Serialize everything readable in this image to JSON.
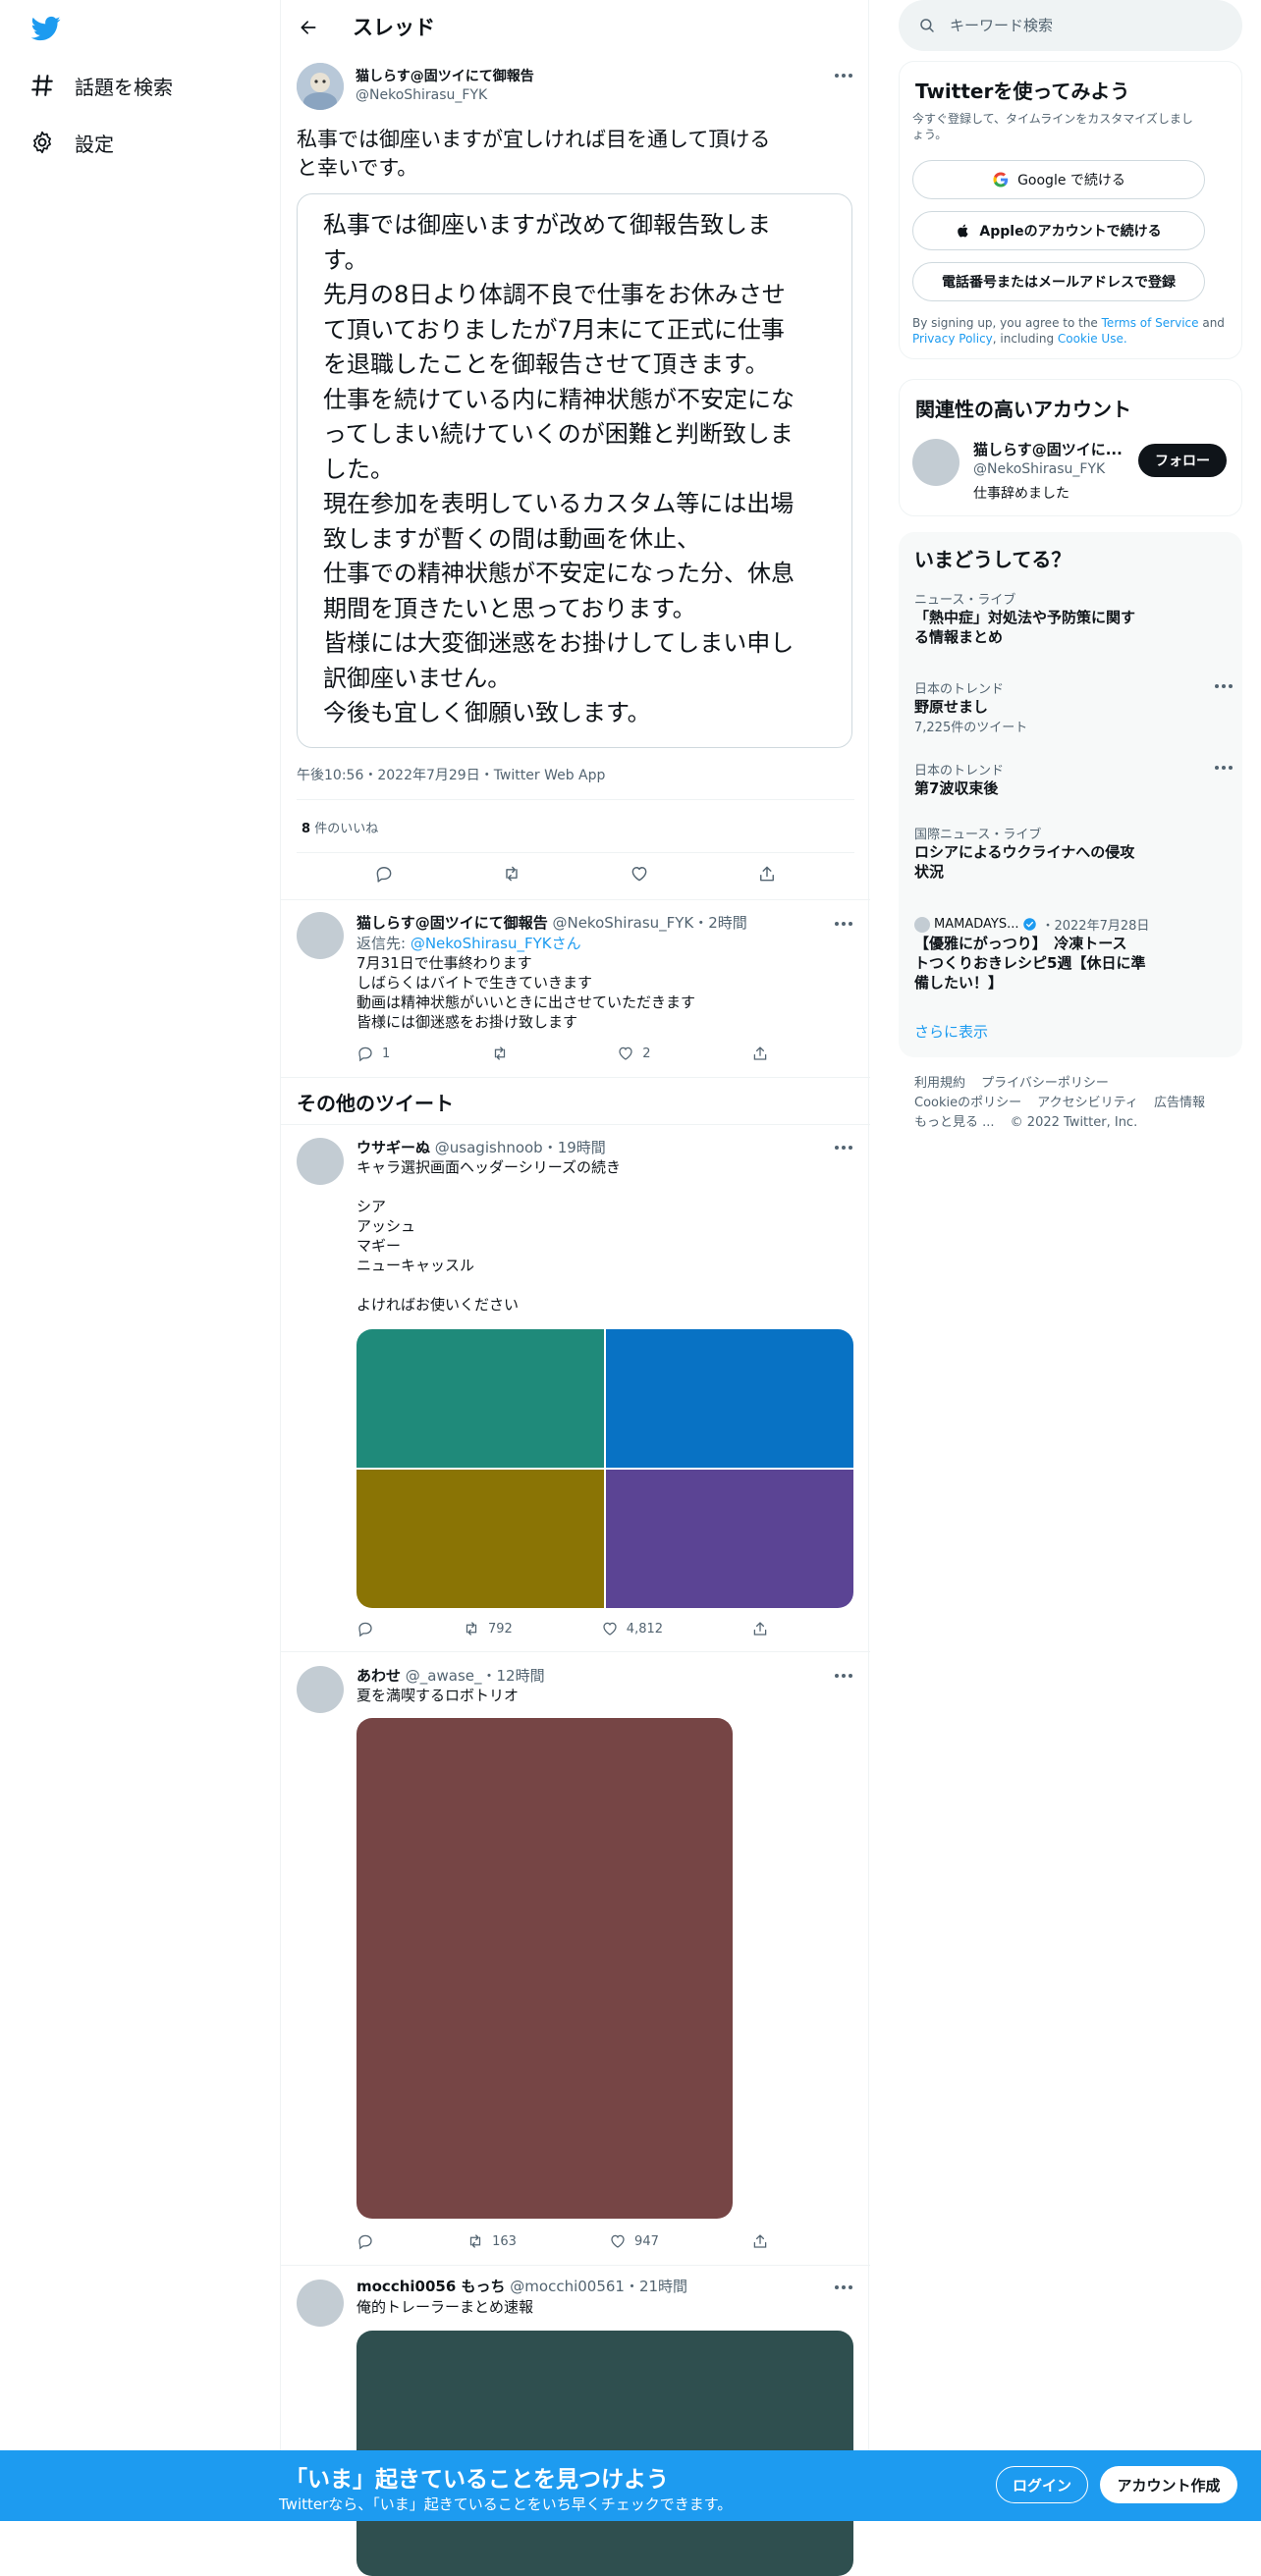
{
  "nav": {
    "explore": "話題を検索",
    "settings": "設定"
  },
  "header": {
    "title": "スレッド"
  },
  "main_tweet": {
    "name": "猫しらす@固ツイにて御報告",
    "handle": "@NekoShirasu_FYK",
    "text_lines": [
      "私事では御座いますが宜しければ目を通して頂ける",
      "と幸いです。"
    ],
    "quote_lines": [
      "私事では御座いますが改めて御報告致しま",
      "す。",
      "先月の8日より体調不良で仕事をお休みさせ",
      "て頂いておりましたが7月末にて正式に仕事",
      "を退職したことを御報告させて頂きます。",
      "仕事を続けている内に精神状態が不安定にな",
      "ってしまい続けていくのが困難と判断致しま",
      "した。",
      "現在参加を表明しているカスタム等には出場",
      "致しますが暫くの間は動画を休止、",
      "仕事での精神状態が不安定になった分、休息",
      "期間を頂きたいと思っております。",
      "皆様には大変御迷惑をお掛けしてしまい申し",
      "訳御座いません。",
      "今後も宜しく御願い致します。"
    ],
    "timestamp": "午後10:56・2022年7月29日・Twitter Web App",
    "likes_count": "8",
    "likes_label": "件のいいね"
  },
  "reply": {
    "name": "猫しらす@固ツイにて御報告",
    "handle_time": "@NekoShirasu_FYK・2時間",
    "reply_prefix": "返信先: ",
    "reply_to": "@NekoShirasu_FYK",
    "reply_suffix": "さん",
    "lines": [
      "7月31日で仕事終わります",
      "しばらくはバイトで生きていきます",
      "動画は精神状態がいいときに出させていただきます",
      "皆様には御迷惑をお掛け致します"
    ],
    "replies": "1",
    "retweets": "",
    "likes": "2"
  },
  "other_tweets_title": "その他のツイート",
  "tweet1": {
    "name": "ウサギーぬ",
    "handle_time": "@usagishnoob・19時間",
    "lines": [
      "キャラ選択画面ヘッダーシリーズの続き",
      "",
      "シア",
      "アッシュ",
      "マギー",
      "ニューキャッスル",
      "",
      "よければお使いください"
    ],
    "retweets": "792",
    "likes": "4,812",
    "media_colors": [
      "#1f8a7a",
      "#0872c4",
      "#8a7405",
      "#5b4494"
    ]
  },
  "tweet2": {
    "name": "あわせ",
    "handle_time": "@_awase_・12時間",
    "text": "夏を満喫するロボトリオ",
    "retweets": "163",
    "likes": "947",
    "media_color": "#764545"
  },
  "tweet3": {
    "name": "mocchi0056 もっち",
    "handle_time": "@mocchi00561・21時間",
    "text": "俺的トレーラーまとめ速報",
    "media_color": "#2f4f4f"
  },
  "right": {
    "search_placeholder": "キーワード検索",
    "signup_card": {
      "title": "Twitterを使ってみよう",
      "subtitle_lines": [
        "今すぐ登録して、タイムラインをカスタマイズしまし",
        "ょう。"
      ],
      "google": "Google で続ける",
      "apple": "Appleのアカウントで続ける",
      "phone": "電話番号またはメールアドレスで登録",
      "terms_pre": "By signing up, you agree to the ",
      "terms_link": "Terms of Service",
      "terms_and": " and",
      "privacy_link": "Privacy Policy",
      "terms_incl": ", including ",
      "cookie_link": "Cookie Use."
    },
    "related_card": {
      "title": "関連性の高いアカウント",
      "name": "猫しらす@固ツイに...",
      "handle": "@NekoShirasu_FYK",
      "bio": "仕事辞めました",
      "follow": "フォロー"
    },
    "trends": {
      "title": "いまどうしてる？",
      "items": [
        {
          "cat": "ニュース・ライブ",
          "title": "「熱中症」対処法や予防策に関す",
          "title2": "る情報まとめ",
          "count": ""
        },
        {
          "cat": "日本のトレンド",
          "title": "野原せまし",
          "title2": "",
          "count": "7,225件のツイート"
        },
        {
          "cat": "日本のトレンド",
          "title": "第7波収束後",
          "title2": "",
          "count": ""
        },
        {
          "cat": "国際ニュース・ライブ",
          "title": "ロシアによるウクライナへの侵攻",
          "title2": "状況",
          "count": ""
        }
      ],
      "promo": {
        "source": "MAMADAYS...",
        "date": "・2022年7月28日",
        "line1": "【優雅にがっつり】　冷凍トース",
        "line2": "トつくりおきレシピ5週【休日に準",
        "line3": "備したい！】"
      },
      "show_more": "さらに表示"
    },
    "footer": {
      "line1": [
        "利用規約",
        "プライバシーポリシー"
      ],
      "line2": [
        "Cookieのポリシー",
        "アクセシビリティ",
        "広告情報"
      ],
      "more": "もっと見る ...",
      "copyright": "© 2022 Twitter, Inc."
    }
  },
  "banner": {
    "title": "「いま」起きていることを見つけよう",
    "subtitle": "Twitterなら、「いま」起きていることをいち早くチェックできます。",
    "login": "ログイン",
    "signup": "アカウント作成"
  },
  "colors": {
    "twitter_blue": "#1d9bf0",
    "text": "#0f1419",
    "secondary": "#536471"
  }
}
